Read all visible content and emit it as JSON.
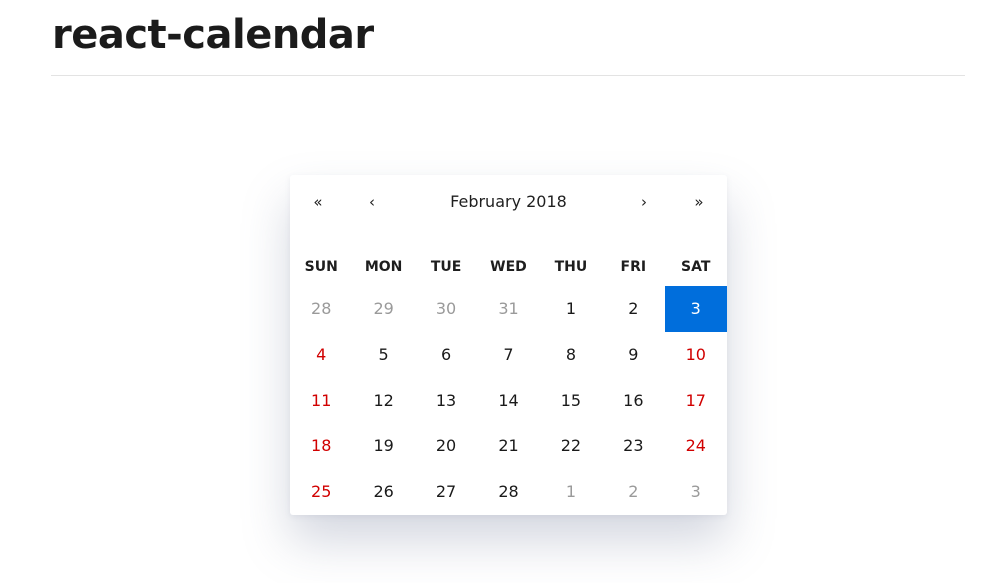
{
  "page": {
    "title": "react-calendar"
  },
  "calendar": {
    "nav": {
      "prev_year": "«",
      "prev_month": "‹",
      "label": "February 2018",
      "next_month": "›",
      "next_year": "»"
    },
    "weekdays": [
      "SUN",
      "MON",
      "TUE",
      "WED",
      "THU",
      "FRI",
      "SAT"
    ],
    "days": [
      {
        "label": "28",
        "neighbor": true,
        "weekend": false,
        "active": false
      },
      {
        "label": "29",
        "neighbor": true,
        "weekend": false,
        "active": false
      },
      {
        "label": "30",
        "neighbor": true,
        "weekend": false,
        "active": false
      },
      {
        "label": "31",
        "neighbor": true,
        "weekend": false,
        "active": false
      },
      {
        "label": "1",
        "neighbor": false,
        "weekend": false,
        "active": false
      },
      {
        "label": "2",
        "neighbor": false,
        "weekend": false,
        "active": false
      },
      {
        "label": "3",
        "neighbor": false,
        "weekend": true,
        "active": true
      },
      {
        "label": "4",
        "neighbor": false,
        "weekend": true,
        "active": false
      },
      {
        "label": "5",
        "neighbor": false,
        "weekend": false,
        "active": false
      },
      {
        "label": "6",
        "neighbor": false,
        "weekend": false,
        "active": false
      },
      {
        "label": "7",
        "neighbor": false,
        "weekend": false,
        "active": false
      },
      {
        "label": "8",
        "neighbor": false,
        "weekend": false,
        "active": false
      },
      {
        "label": "9",
        "neighbor": false,
        "weekend": false,
        "active": false
      },
      {
        "label": "10",
        "neighbor": false,
        "weekend": true,
        "active": false
      },
      {
        "label": "11",
        "neighbor": false,
        "weekend": true,
        "active": false
      },
      {
        "label": "12",
        "neighbor": false,
        "weekend": false,
        "active": false
      },
      {
        "label": "13",
        "neighbor": false,
        "weekend": false,
        "active": false
      },
      {
        "label": "14",
        "neighbor": false,
        "weekend": false,
        "active": false
      },
      {
        "label": "15",
        "neighbor": false,
        "weekend": false,
        "active": false
      },
      {
        "label": "16",
        "neighbor": false,
        "weekend": false,
        "active": false
      },
      {
        "label": "17",
        "neighbor": false,
        "weekend": true,
        "active": false
      },
      {
        "label": "18",
        "neighbor": false,
        "weekend": true,
        "active": false
      },
      {
        "label": "19",
        "neighbor": false,
        "weekend": false,
        "active": false
      },
      {
        "label": "20",
        "neighbor": false,
        "weekend": false,
        "active": false
      },
      {
        "label": "21",
        "neighbor": false,
        "weekend": false,
        "active": false
      },
      {
        "label": "22",
        "neighbor": false,
        "weekend": false,
        "active": false
      },
      {
        "label": "23",
        "neighbor": false,
        "weekend": false,
        "active": false
      },
      {
        "label": "24",
        "neighbor": false,
        "weekend": true,
        "active": false
      },
      {
        "label": "25",
        "neighbor": false,
        "weekend": true,
        "active": false
      },
      {
        "label": "26",
        "neighbor": false,
        "weekend": false,
        "active": false
      },
      {
        "label": "27",
        "neighbor": false,
        "weekend": false,
        "active": false
      },
      {
        "label": "28",
        "neighbor": false,
        "weekend": false,
        "active": false
      },
      {
        "label": "1",
        "neighbor": true,
        "weekend": false,
        "active": false
      },
      {
        "label": "2",
        "neighbor": true,
        "weekend": false,
        "active": false
      },
      {
        "label": "3",
        "neighbor": true,
        "weekend": false,
        "active": false
      }
    ]
  },
  "colors": {
    "active_tile": "#006edc",
    "weekend_text": "#d10000",
    "neighbor_text": "#9a9a9a"
  }
}
